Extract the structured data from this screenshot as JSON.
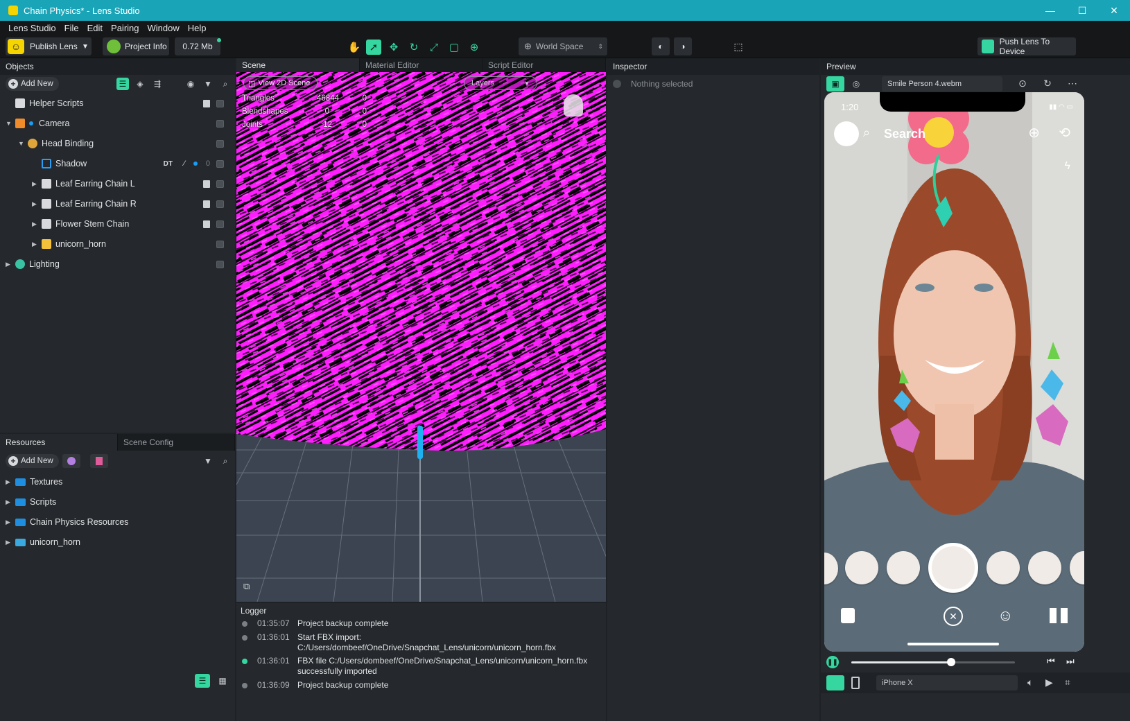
{
  "window": {
    "title": "Chain Physics* - Lens Studio",
    "minimize": "—",
    "maximize": "☐",
    "close": "✕"
  },
  "menu": [
    "Lens Studio",
    "File",
    "Edit",
    "Pairing",
    "Window",
    "Help"
  ],
  "toolbar": {
    "publish_label": "Publish Lens",
    "project_info_label": "Project Info",
    "size_label": "0.72 Mb",
    "space_label": "World Space",
    "push_label": "Push Lens To Device"
  },
  "objects_panel": {
    "title": "Objects",
    "add_new": "Add New",
    "items": [
      {
        "label": "Helper Scripts",
        "indent": 0,
        "icon": "script-icon",
        "expand": ""
      },
      {
        "label": "Camera",
        "indent": 0,
        "icon": "camera-icon",
        "expand": "▼"
      },
      {
        "label": "Head Binding",
        "indent": 1,
        "icon": "head-binding-icon",
        "expand": "▼"
      },
      {
        "label": "Shadow",
        "indent": 2,
        "icon": "mesh-icon",
        "expand": "",
        "extra": "DT",
        "count": "0"
      },
      {
        "label": "Leaf Earring Chain L",
        "indent": 2,
        "icon": "script-icon",
        "expand": "▶"
      },
      {
        "label": "Leaf Earring Chain R",
        "indent": 2,
        "icon": "script-icon",
        "expand": "▶"
      },
      {
        "label": "Flower Stem Chain",
        "indent": 2,
        "icon": "script-icon",
        "expand": "▶"
      },
      {
        "label": "unicorn_horn",
        "indent": 2,
        "icon": "mesh-object-icon",
        "expand": "▶"
      },
      {
        "label": "Lighting",
        "indent": 0,
        "icon": "lighting-icon",
        "expand": "▶"
      }
    ]
  },
  "resources_panel": {
    "tabs": [
      "Resources",
      "Scene Config"
    ],
    "add_new": "Add New",
    "items": [
      {
        "label": "Textures"
      },
      {
        "label": "Scripts"
      },
      {
        "label": "Chain Physics Resources"
      },
      {
        "label": "unicorn_horn"
      }
    ]
  },
  "scene_panel": {
    "tabs": [
      "Scene",
      "Material Editor",
      "Script Editor"
    ],
    "view_2d": "View 2D Scene",
    "layers": "Layers",
    "stats": [
      {
        "label": "Triangles",
        "value": "46844",
        "extra": "0"
      },
      {
        "label": "Blendshapes",
        "value": "0",
        "extra": "0"
      },
      {
        "label": "Joints",
        "value": "12",
        "extra": "0"
      }
    ]
  },
  "inspector": {
    "title": "Inspector",
    "empty": "Nothing selected"
  },
  "logger": {
    "title": "Logger",
    "entries": [
      {
        "time": "01:35:07",
        "msg": "Project backup complete",
        "status": "gray"
      },
      {
        "time": "01:36:01",
        "msg": "Start FBX import: C:/Users/dombeef/OneDrive/Snapchat_Lens/unicorn/unicorn_horn.fbx",
        "status": "gray"
      },
      {
        "time": "01:36:01",
        "msg": "FBX file C:/Users/dombeef/OneDrive/Snapchat_Lens/unicorn/unicorn_horn.fbx successfully imported",
        "status": "green"
      },
      {
        "time": "01:36:09",
        "msg": "Project backup complete",
        "status": "gray"
      }
    ]
  },
  "preview": {
    "title": "Preview",
    "video": "Smile Person 4.webm",
    "device": "iPhone X",
    "phone_time": "1:20",
    "search": "Search",
    "playback_progress": 0.61
  },
  "colors": {
    "accent": "#36d6a0",
    "titlebar": "#1aa4b8",
    "magenta": "#ff00ff"
  }
}
